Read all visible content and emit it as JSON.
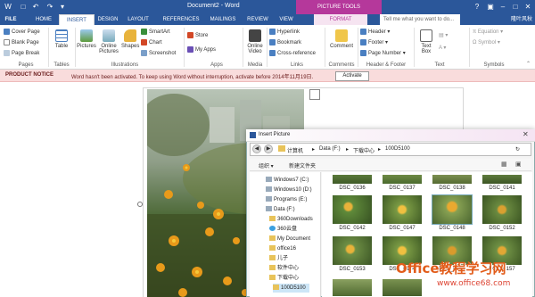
{
  "window": {
    "title": "Document2 - Word",
    "context_tab_group": "PICTURE TOOLS",
    "user": "隆叶风秋"
  },
  "tabs": [
    "FILE",
    "INSERT",
    "DESIGN",
    "LAYOUT",
    "REFERENCES",
    "MAILINGS",
    "REVIEW",
    "VIEW",
    "FORMAT"
  ],
  "tell_me_placeholder": "Tell me what you want to do...",
  "ribbon": {
    "pages": {
      "items": [
        "Cover Page",
        "Blank Page",
        "Page Break"
      ],
      "label": "Pages"
    },
    "tables": {
      "button": "Table",
      "label": "Tables"
    },
    "illustrations": {
      "pictures": "Pictures",
      "online_pictures": "Online Pictures",
      "shapes": "Shapes",
      "smartart": "SmartArt",
      "chart": "Chart",
      "screenshot": "Screenshot",
      "label": "Illustrations"
    },
    "apps": {
      "store": "Store",
      "my_apps": "My Apps",
      "label": "Apps"
    },
    "media": {
      "online_video": "Online Video",
      "label": "Media"
    },
    "links": {
      "items": [
        "Hyperlink",
        "Bookmark",
        "Cross-reference"
      ],
      "label": "Links"
    },
    "comments": {
      "comment": "Comment",
      "label": "Comments"
    },
    "header_footer": {
      "items": [
        "Header",
        "Footer",
        "Page Number"
      ],
      "label": "Header & Footer"
    },
    "text": {
      "text_box": "Text Box",
      "label": "Text"
    },
    "symbols": {
      "items": [
        "Equation",
        "Symbol"
      ],
      "label": "Symbols"
    }
  },
  "notice": {
    "title": "PRODUCT NOTICE",
    "text": "Word hasn't been activated. To keep using Word without interruption, activate before 2014年11月19日.",
    "button": "Activate"
  },
  "dialog": {
    "title": "Insert Picture",
    "breadcrumbs": [
      "计算机",
      "Data (F:)",
      "下载中心",
      "100D5100"
    ],
    "organize": "组织",
    "new_folder": "新建文件夹",
    "nav_items": [
      "Windows7 (C:)",
      "Windows10 (D:)",
      "Programs (E:)",
      "Data (F:)",
      "360Downloads",
      "360云盘",
      "My Document",
      "office16",
      "儿子",
      "软件中心",
      "下载中心",
      "100D5100"
    ],
    "thumbnails": [
      [
        "DSC_0136",
        "DSC_0137",
        "DSC_0138",
        "DSC_0141"
      ],
      [
        "DSC_0142",
        "DSC_0147",
        "DSC_0148",
        "DSC_0152"
      ],
      [
        "DSC_0153",
        "DSC_0154",
        "DSC_0155",
        "DSC_0157"
      ]
    ]
  },
  "watermark": {
    "text": "Office教程学习网",
    "url": "www.office68.com"
  },
  "colors": {
    "word_blue": "#2b579a",
    "picture_tools": "#b5389b",
    "notice_bg": "#f9dcdc"
  }
}
